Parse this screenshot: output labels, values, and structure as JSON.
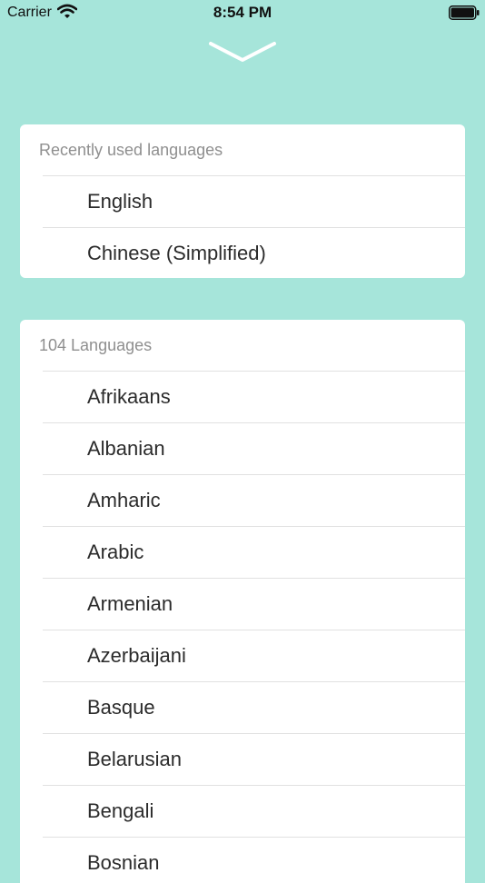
{
  "status_bar": {
    "carrier": "Carrier",
    "time": "8:54 PM",
    "wifi_icon": "wifi-icon",
    "battery_icon": "battery-icon"
  },
  "dismiss_icon": "chevron-down-icon",
  "recent": {
    "header": "Recently used languages",
    "items": [
      "English",
      "Chinese (Simplified)"
    ]
  },
  "all": {
    "header": "104 Languages",
    "items": [
      "Afrikaans",
      "Albanian",
      "Amharic",
      "Arabic",
      "Armenian",
      "Azerbaijani",
      "Basque",
      "Belarusian",
      "Bengali",
      "Bosnian"
    ]
  },
  "colors": {
    "background": "#a6e5da",
    "card": "#ffffff",
    "header_text": "#8f8f8f",
    "item_text": "#2b2b2b"
  }
}
